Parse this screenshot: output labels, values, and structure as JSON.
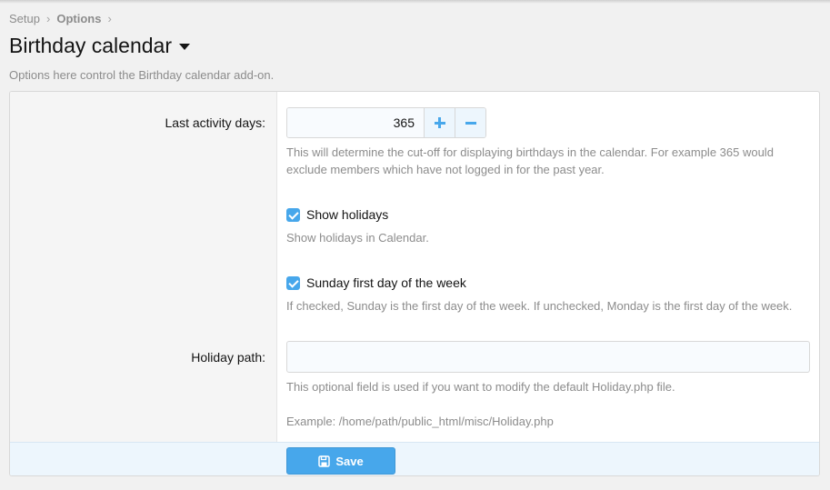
{
  "breadcrumb": {
    "items": [
      "Setup",
      "Options"
    ],
    "separator": "›"
  },
  "page": {
    "title": "Birthday calendar",
    "description": "Options here control the Birthday calendar add-on."
  },
  "options": {
    "last_activity_days": {
      "label": "Last activity days:",
      "value": "365",
      "hint_line1": "This will determine the cut-off for displaying birthdays in the calendar. For example 365 would",
      "hint_line2": "exclude members which have not logged in for the past year."
    },
    "show_holidays": {
      "label": "Show holidays",
      "checked": true,
      "hint": "Show holidays in Calendar."
    },
    "sunday_first": {
      "label": "Sunday first day of the week",
      "checked": true,
      "hint": "If checked, Sunday is the first day of the week. If unchecked, Monday is the first day of the week."
    },
    "holiday_path": {
      "label": "Holiday path:",
      "value": "",
      "hint": "This optional field is used if you want to modify the default Holiday.php file.",
      "example": "Example: /home/path/public_html/misc/Holiday.php"
    }
  },
  "footer": {
    "save_label": "Save"
  },
  "colors": {
    "accent": "#47a7eb",
    "footer_bg": "#edf6fd",
    "muted_text": "#8c8c8c"
  },
  "icons": {
    "caret": "caret-down-icon",
    "plus": "plus-icon",
    "minus": "minus-icon",
    "checkbox": "checkmark-icon",
    "save": "floppy-disk-icon"
  }
}
